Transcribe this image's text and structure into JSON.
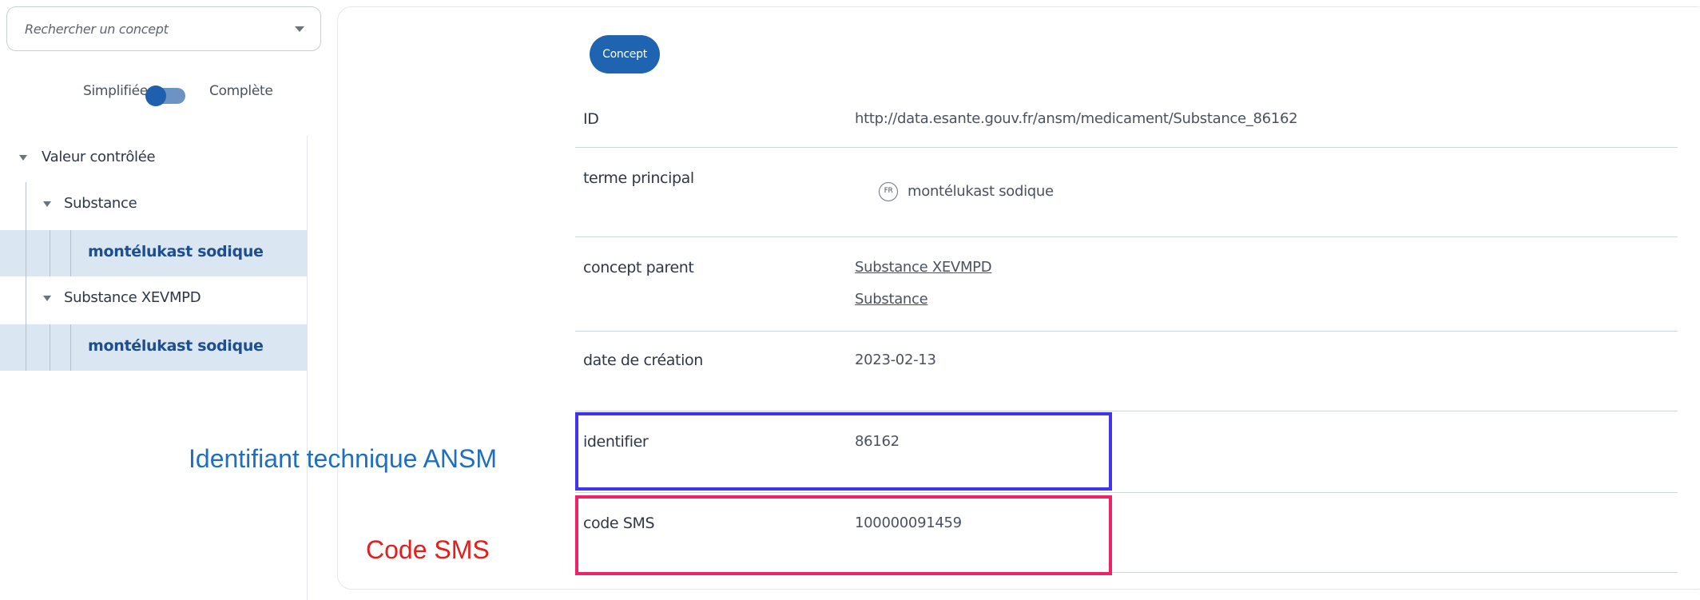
{
  "search": {
    "placeholder": "Rechercher un concept"
  },
  "toggle": {
    "left_label": "Simplifiée",
    "right_label": "Complète"
  },
  "tree": {
    "root": "Valeur contrôlée",
    "nodes": [
      {
        "label": "Substance"
      },
      {
        "label": "montélukast sodique",
        "selected": true
      },
      {
        "label": "Substance XEVMPD"
      },
      {
        "label": "montélukast sodique",
        "selected": true
      }
    ]
  },
  "concept_button": "Concept",
  "properties": {
    "id": {
      "key": "ID",
      "value": "http://data.esante.gouv.fr/ansm/medicament/Substance_86162"
    },
    "pref_term": {
      "key": "terme principal",
      "lang": "FR",
      "value": "montélukast sodique"
    },
    "parent": {
      "key": "concept parent",
      "links": [
        "Substance XEVMPD",
        "Substance"
      ]
    },
    "created": {
      "key": "date de création",
      "value": "2023-02-13"
    },
    "identifier": {
      "key": "identifier",
      "value": "86162"
    },
    "sms": {
      "key": "code SMS",
      "value": "100000091459"
    }
  },
  "annotations": {
    "identifier_label": "Identifiant technique ANSM",
    "sms_label": "Code SMS",
    "identifier_color": "#4433ee",
    "sms_color": "#ee2266",
    "identifier_text_color": "#1e6fc0",
    "sms_text_color": "#e81c1c"
  },
  "colors": {
    "accent": "#1e64b0",
    "selected_bg": "#dae6f2"
  }
}
